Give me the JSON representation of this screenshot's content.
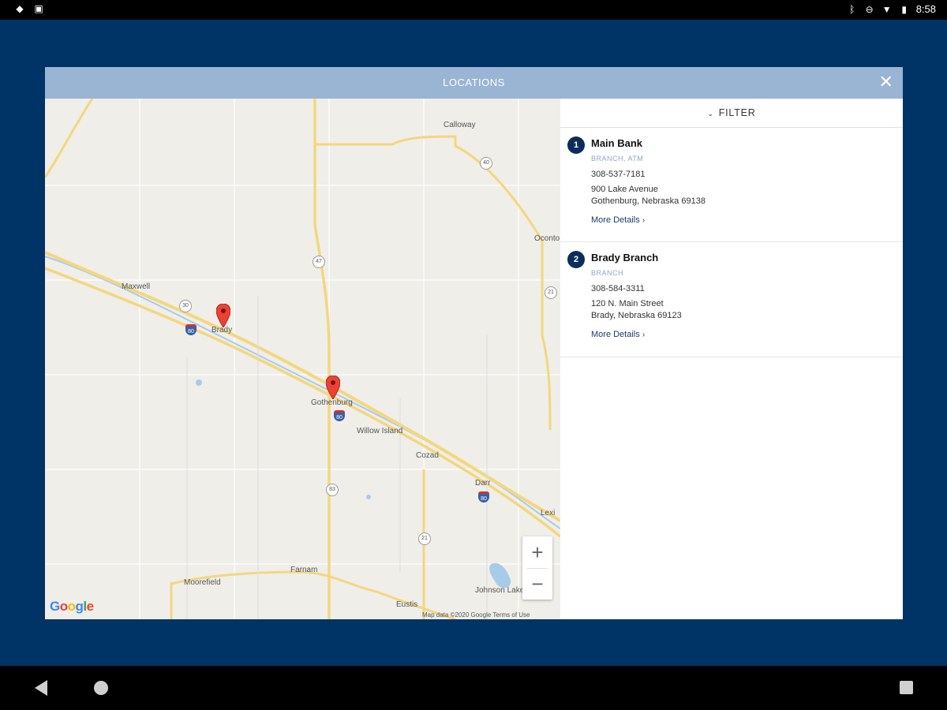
{
  "status_bar": {
    "left_icons": [
      "dropbox-icon",
      "image-icon"
    ],
    "right_icons": [
      "bluetooth-icon",
      "dnd-icon",
      "wifi-icon",
      "battery-icon"
    ],
    "time": "8:58"
  },
  "modal": {
    "title": "LOCATIONS",
    "close_icon": "close-icon"
  },
  "filter": {
    "label": "FILTER"
  },
  "locations": [
    {
      "number": "1",
      "name": "Main Bank",
      "type": "BRANCH, ATM",
      "phone": "308-537-7181",
      "street": "900 Lake Avenue",
      "city": "Gothenburg, Nebraska 69138",
      "more": "More Details"
    },
    {
      "number": "2",
      "name": "Brady Branch",
      "type": "BRANCH",
      "phone": "308-584-3311",
      "street": "120 N. Main Street",
      "city": "Brady, Nebraska 69123",
      "more": "More Details"
    }
  ],
  "map": {
    "towns": [
      "Calloway",
      "Maxwell",
      "Brady",
      "Gothenburg",
      "Willow Island",
      "Cozad",
      "Darr",
      "Farnam",
      "Moorefield",
      "Johnson Lake",
      "Eustis",
      "Lexi",
      "Oconto"
    ],
    "shields": [
      "40",
      "47",
      "30",
      "21",
      "83",
      "21"
    ],
    "interstates": [
      "80",
      "80",
      "80"
    ],
    "zoom_in": "+",
    "zoom_out": "−",
    "google_logo": [
      "G",
      "o",
      "o",
      "g",
      "l",
      "e"
    ],
    "attribution": "Map data ©2020 Google   Terms of Use"
  },
  "colors": {
    "background": "#003366",
    "header": "#9ab4d4",
    "badge": "#0b2d5c",
    "branch_type": "#8fa7c6",
    "pin": "#ea4335"
  }
}
